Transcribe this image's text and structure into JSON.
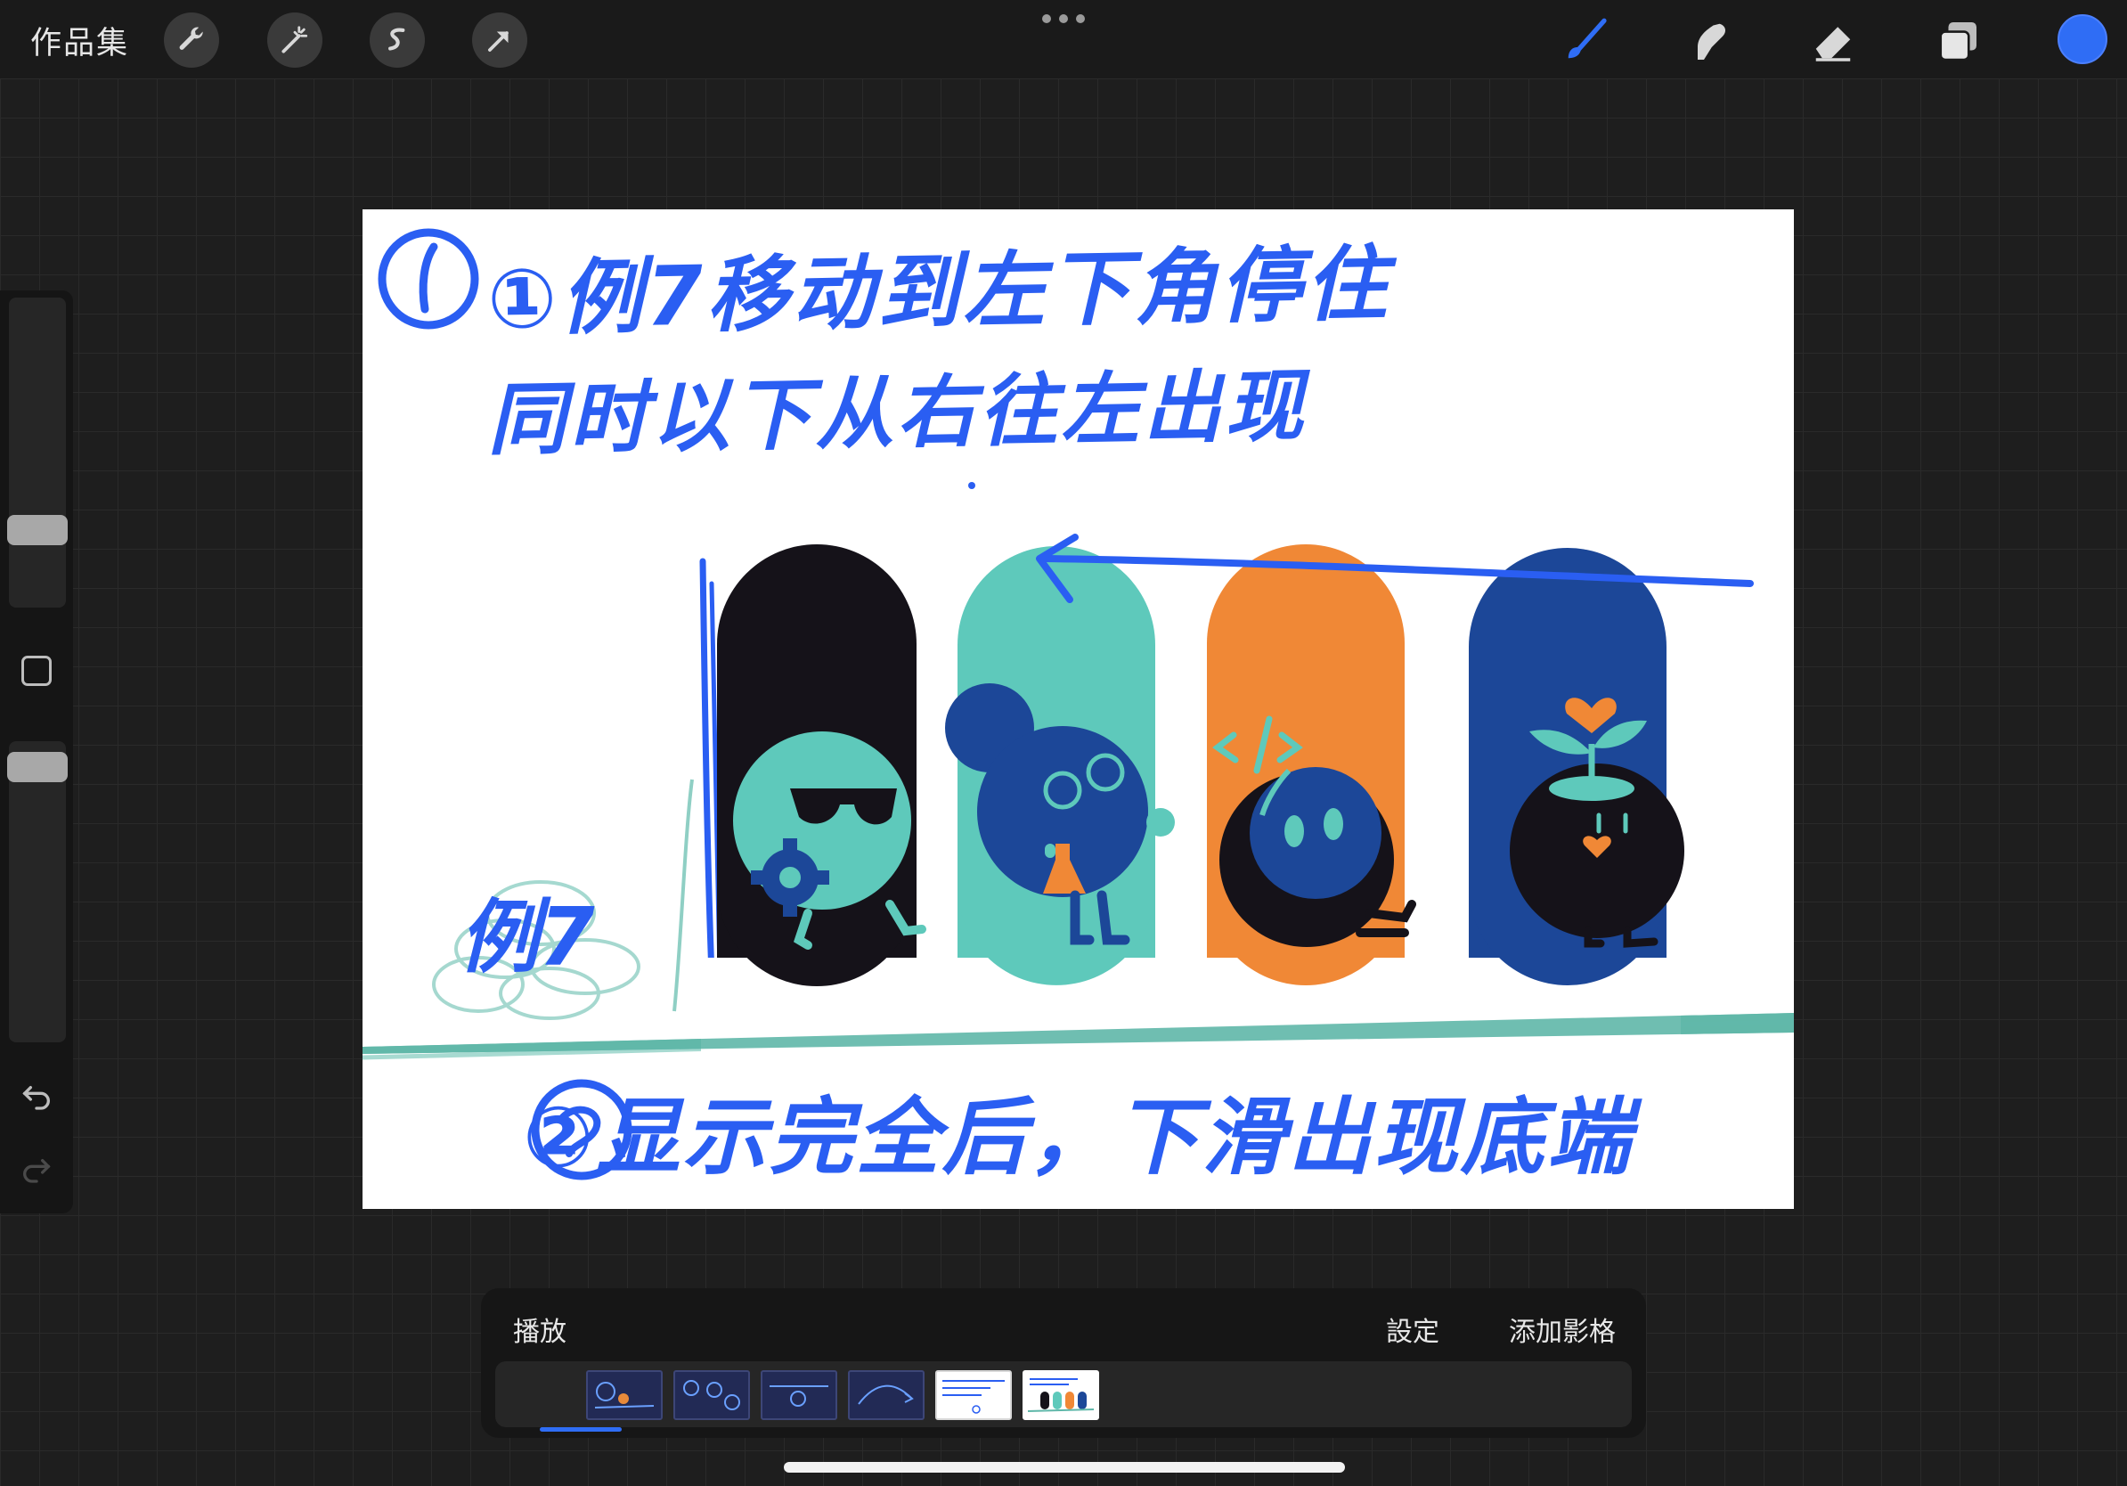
{
  "topbar": {
    "gallery_label": "作品集",
    "tools_left": [
      "wrench-icon",
      "magic-wand-icon",
      "selection-icon",
      "transform-arrow-icon"
    ],
    "tools_right": [
      "brush-icon",
      "smudge-icon",
      "eraser-icon",
      "layers-icon"
    ],
    "current_color": "#2f6df5"
  },
  "sidebar": {
    "controls": [
      "brush-size-slider",
      "modify-button",
      "opacity-slider",
      "undo-icon",
      "redo-icon"
    ]
  },
  "canvas": {
    "note_line_1": "①例7移动到左下角停住",
    "note_line_2": "同时以下从右往左出现",
    "note_bottom": "②显示完全后，下滑出现底端",
    "note_label": "例7",
    "colors": {
      "ink_blue": "#2a5ef2",
      "pill_black": "#151219",
      "pill_teal": "#5ec9bb",
      "pill_orange": "#f08836",
      "pill_navy": "#1c4798",
      "ground_teal": "#5fb7a9"
    }
  },
  "animation": {
    "play_label": "播放",
    "settings_label": "設定",
    "add_frame_label": "添加影格",
    "frame_count": 6,
    "selected_frame": 6
  }
}
